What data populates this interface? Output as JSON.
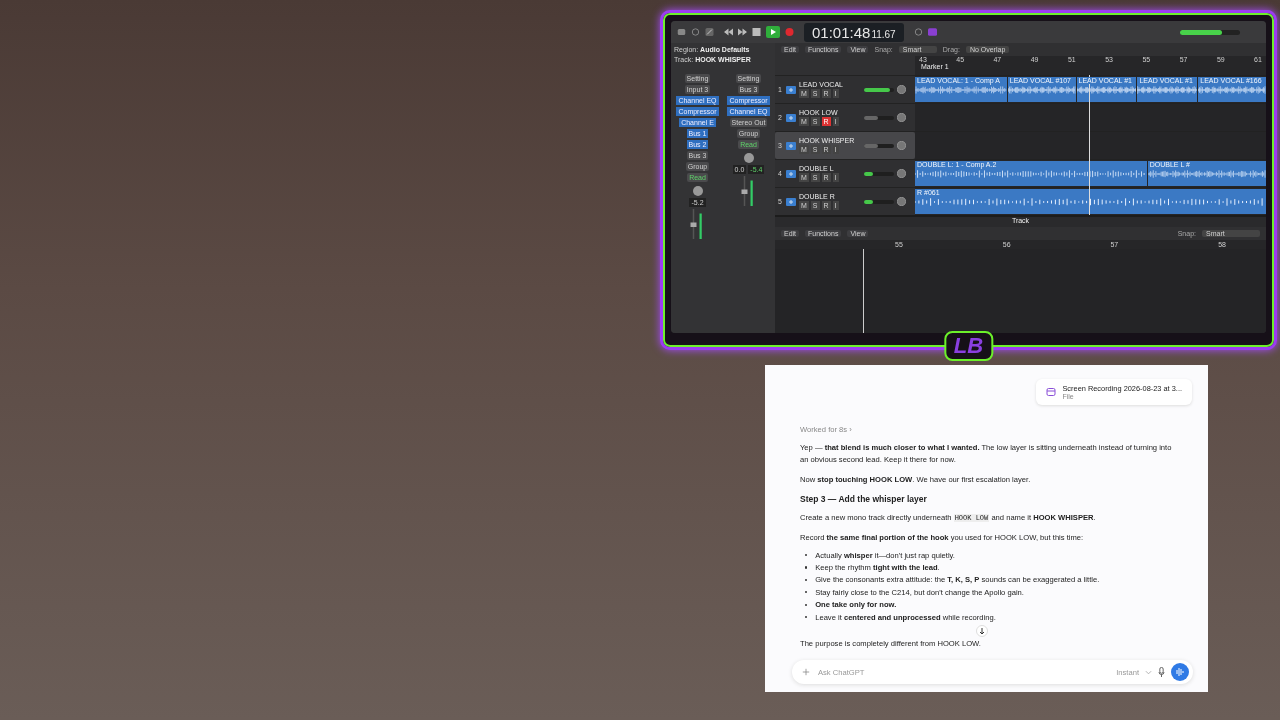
{
  "daw": {
    "transport": {
      "playing": true,
      "time": "01:01:48",
      "frames": "11.67"
    },
    "master_volume": {
      "level": 0.7
    },
    "inspector": {
      "region_label": "Region:",
      "region": "Audio Defaults",
      "track_label": "Track:",
      "track": "HOOK WHISPER"
    },
    "menu": [
      "Edit",
      "Functions",
      "View"
    ],
    "snap_label": "Snap:",
    "snap": "Smart",
    "drag_label": "Drag:",
    "drag": "No Overlap",
    "ruler": [
      "43",
      "45",
      "47",
      "49",
      "51",
      "53",
      "55",
      "57",
      "59",
      "61"
    ],
    "marker": "Marker 1",
    "channel_strips": [
      {
        "setting": "Setting",
        "input": "Input 3",
        "plugins": [
          "Channel EQ",
          "Compressor",
          "Channel E"
        ],
        "sends": [
          "Bus 1",
          "Bus 2"
        ],
        "output": "Bus 3",
        "group": "Group",
        "automation": "Read",
        "volume": "-5.2"
      },
      {
        "setting": "Setting",
        "input": "Bus 3",
        "plugins": [
          "Compressor",
          "Channel EQ"
        ],
        "output": "Stereo Out",
        "group": "Group",
        "automation": "Read",
        "volume": "0.0",
        "peak": "-5.4"
      }
    ],
    "tracks": [
      {
        "number": "1",
        "name": "LEAD VOCAL",
        "buttons": [
          "M",
          "S",
          "R",
          "I"
        ],
        "selected": false,
        "armed": false,
        "metering": true,
        "level": 0.85,
        "regions": [
          "LEAD VOCAL: 1 - Comp A",
          "LEAD VOCAL #107",
          "LEAD VOCAL #1",
          "LEAD VOCAL #1",
          "LEAD VOCAL #166"
        ]
      },
      {
        "number": "2",
        "name": "HOOK LOW",
        "buttons": [
          "M",
          "S",
          "R",
          "I"
        ],
        "selected": false,
        "armed": true,
        "metering": false,
        "level": 0.45
      },
      {
        "number": "3",
        "name": "HOOK WHISPER",
        "buttons": [
          "M",
          "S",
          "R",
          "I"
        ],
        "selected": true,
        "armed": false,
        "metering": false,
        "level": 0.45
      },
      {
        "number": "4",
        "name": "DOUBLE L",
        "buttons": [
          "M",
          "S",
          "R",
          "I"
        ],
        "selected": false,
        "armed": false,
        "metering": true,
        "level": 0.3,
        "regions": [
          "DOUBLE L: 1 - Comp A.2",
          "DOUBLE L #"
        ]
      },
      {
        "number": "5",
        "name": "DOUBLE R",
        "buttons": [
          "M",
          "S",
          "R",
          "I"
        ],
        "selected": false,
        "armed": false,
        "metering": true,
        "level": 0.3,
        "regions": [
          "R #061"
        ]
      }
    ],
    "editor": {
      "title": "Track",
      "menu": [
        "Edit",
        "Functions",
        "View"
      ],
      "snap_label": "Snap:",
      "snap": "Smart",
      "ruler": [
        "55",
        "56",
        "57",
        "58"
      ]
    }
  },
  "logo": {
    "text": "LB"
  },
  "chat": {
    "attachment": {
      "name": "Screen Recording 2026-08-23 at 3...",
      "type": "File"
    },
    "worked": "Worked for 8s ›",
    "blocks": [
      {
        "kind": "p",
        "text": "Yep — **that blend is much closer to what I wanted.** The low layer is sitting underneath instead of turning into an obvious second lead. Keep it there for now."
      },
      {
        "kind": "p",
        "text": "Now **stop touching HOOK LOW**. We have our first escalation layer."
      },
      {
        "kind": "h",
        "text": "Step 3 — Add the whisper layer"
      },
      {
        "kind": "code_p",
        "before": "Create a new mono track directly underneath ",
        "code": "HOOK LOW",
        "after": " and name it **HOOK WHISPER**."
      },
      {
        "kind": "p",
        "text": "Record **the same final portion of the hook** you used for HOOK LOW, but this time:"
      },
      {
        "kind": "list",
        "items": [
          "Actually **whisper** it—don't just rap quietly.",
          "Keep the rhythm **tight with the lead**.",
          "Give the consonants extra attitude: the **T, K, S, P** sounds can be exaggerated a little.",
          "Stay fairly close to the C214, but don't change the Apollo gain.",
          "**One take only for now.**",
          "Leave it **centered and unprocessed** while recording."
        ]
      },
      {
        "kind": "p",
        "text": "The purpose is completely different from HOOK LOW."
      }
    ],
    "input": {
      "placeholder": "Ask ChatGPT",
      "mode": "Instant"
    }
  }
}
